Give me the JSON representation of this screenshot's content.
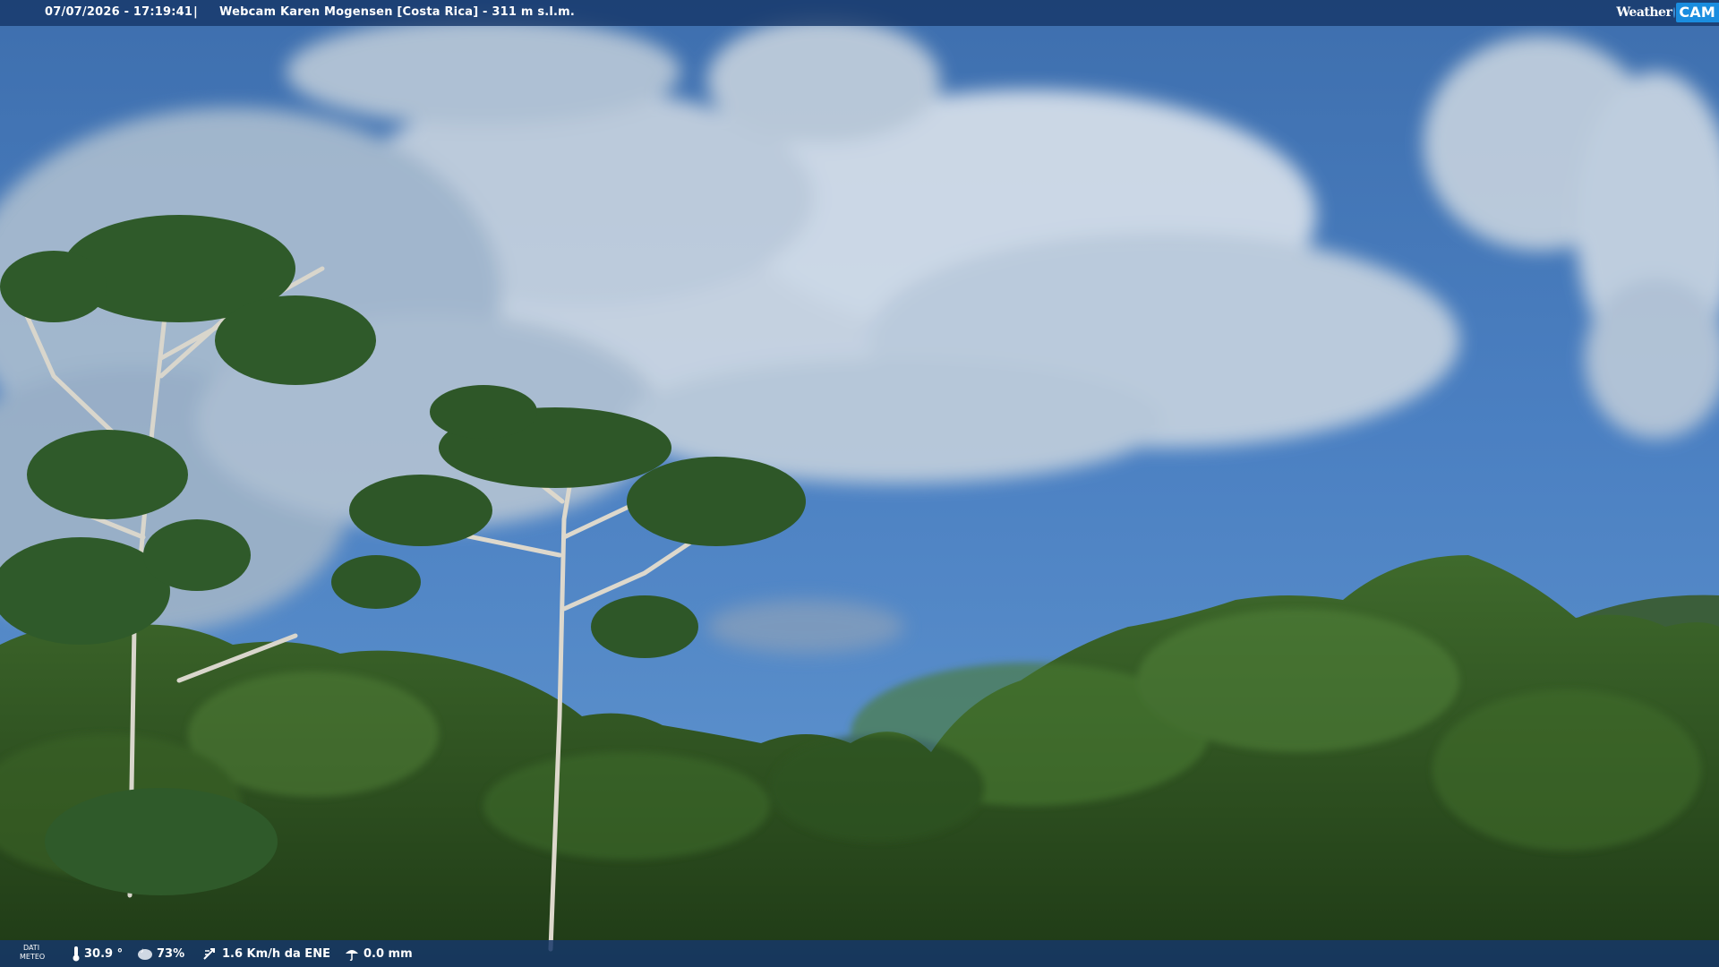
{
  "overlay": {
    "timestamp": "07/07/2026 - 17:19:41",
    "separator": "|",
    "title": "Webcam Karen Mogensen [Costa Rica] - 311 m s.l.m.",
    "logo": {
      "weather": "Weather",
      "cam": "CAM"
    }
  },
  "meteo": {
    "label_line1": "DATI",
    "label_line2": "METEO",
    "temperature": "30.9 °",
    "humidity": "73%",
    "wind": "1.6 Km/h da ENE",
    "rain": "0.0 mm",
    "icons": [
      "thermometer-icon",
      "humidity-icon",
      "wind-icon",
      "rain-icon"
    ]
  },
  "colors": {
    "bar": "#16376a",
    "sky": "#4a7fc0",
    "accent": "#1a8ddf"
  }
}
